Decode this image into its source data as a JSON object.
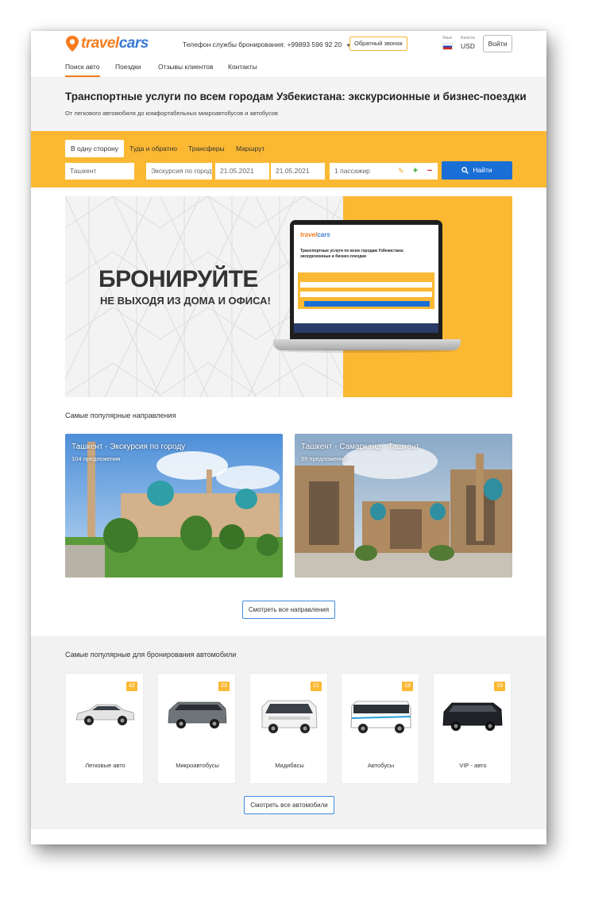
{
  "brand": {
    "part1": "travel",
    "part2": "cars"
  },
  "header": {
    "phone_label": "Телефон службы бронирования:",
    "phone_number": "+99893 596 92 20",
    "callback_label": "Обратный звонок",
    "lang_label": "Язык",
    "currency_label": "Валюта",
    "currency_value": "USD",
    "login_label": "Войти"
  },
  "nav": [
    {
      "label": "Поиск авто",
      "active": true
    },
    {
      "label": "Поездки",
      "active": false
    },
    {
      "label": "Отзывы клиентов",
      "active": false
    },
    {
      "label": "Контакты",
      "active": false
    }
  ],
  "hero": {
    "title": "Транспортные услуги по всем городам Узбекистана: экскурсионные и бизнес-поездки",
    "subtitle": "От легкового автомобиля до комфортабельных микроавтобусов и автобусов"
  },
  "search": {
    "tabs": [
      {
        "label": "В одну сторону",
        "active": true
      },
      {
        "label": "Туда и обратно",
        "active": false
      },
      {
        "label": "Трансферы",
        "active": false
      },
      {
        "label": "Маршрут",
        "active": false
      }
    ],
    "from": "Ташкент",
    "to": "Экскурсия по городу",
    "date_from": "21.05.2021",
    "date_to": "21.05.2021",
    "passengers": "1 пассажир",
    "find_label": "Найти"
  },
  "banner": {
    "headline": "БРОНИРУЙТЕ",
    "subline": "НЕ ВЫХОДЯ ИЗ ДОМА И ОФИСА!",
    "mini_title": "Транспортные услуги по всем городам Узбекистана: экскурсионные и бизнес-поездки"
  },
  "destinations": {
    "title": "Самые популярные направления",
    "items": [
      {
        "name": "Ташкент - Экскурсия по городу",
        "offers": "104 предложения"
      },
      {
        "name": "Ташкент - Самарканд - Ташкент",
        "offers": "99 предложений"
      }
    ],
    "all_label": "Смотреть все направления"
  },
  "cars": {
    "title": "Самые популярные для бронирования автомобили",
    "items": [
      {
        "label": "Легковые авто",
        "count": "42",
        "color": "#e8e8e8"
      },
      {
        "label": "Микроавтобусы",
        "count": "23",
        "color": "#6f7478"
      },
      {
        "label": "Мидибасы",
        "count": "21",
        "color": "#f0f0f0"
      },
      {
        "label": "Автобусы",
        "count": "18",
        "color": "#ffffff"
      },
      {
        "label": "VIP - авто",
        "count": "19",
        "color": "#1f2226"
      }
    ],
    "all_label": "Смотреть все автомобили"
  },
  "colors": {
    "accent": "#fbb833",
    "primary": "#1a6fd6",
    "brand_orange": "#f57c1f"
  }
}
